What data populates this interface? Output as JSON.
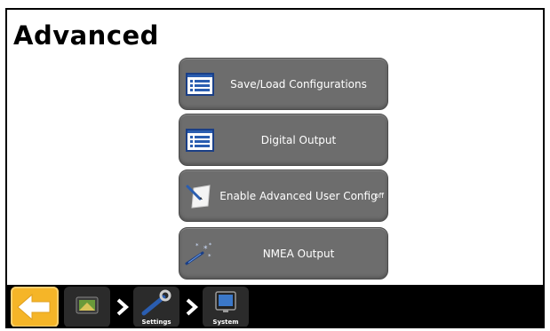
{
  "page": {
    "title": "Advanced"
  },
  "menu": [
    {
      "label": "Save/Load Configurations",
      "icon": "list-icon"
    },
    {
      "label": "Digital Output",
      "icon": "list-icon"
    },
    {
      "label": "Enable Advanced User Config",
      "icon": "edit-note-icon",
      "state": "off"
    },
    {
      "label": "NMEA Output",
      "icon": "magic-wand-icon"
    }
  ],
  "navbar": {
    "back_icon": "back-arrow-icon",
    "crumbs": [
      {
        "label": "",
        "icon": "display-icon"
      },
      {
        "label": "Settings",
        "icon": "wrench-icon"
      },
      {
        "label": "System",
        "icon": "monitor-icon"
      }
    ]
  },
  "colors": {
    "button": "#6d6d6d",
    "accent": "#f5b528",
    "bar": "#000000",
    "icon_blue": "#2a5db0"
  }
}
